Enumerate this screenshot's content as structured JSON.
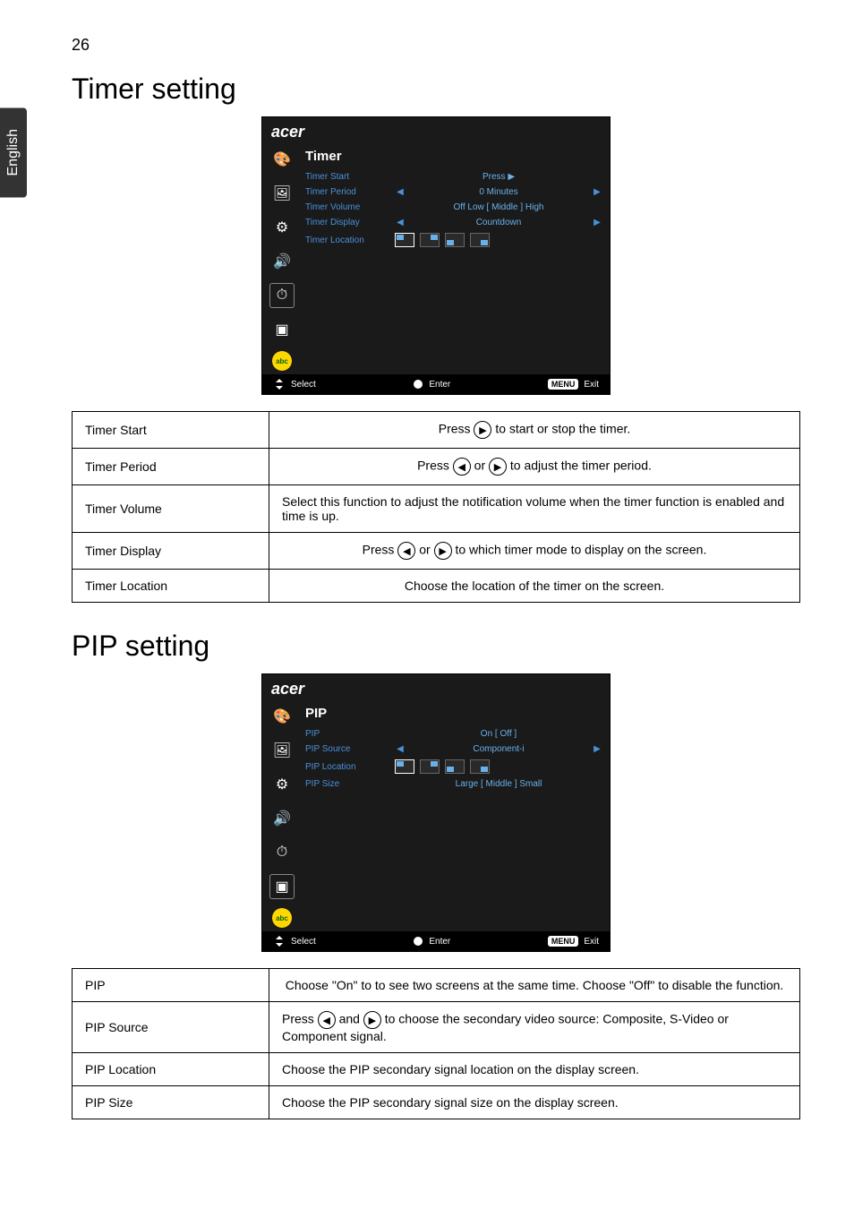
{
  "page_number": "26",
  "side_tab": "English",
  "section_timer": {
    "heading": "Timer setting",
    "osd": {
      "logo": "acer",
      "title": "Timer",
      "rows": [
        {
          "label": "Timer Start",
          "value": "Press  ▶"
        },
        {
          "label": "Timer Period",
          "value": "0  Minutes"
        },
        {
          "label": "Timer Volume",
          "value": "Off    Low    [ Middle ]    High"
        },
        {
          "label": "Timer Display",
          "value": "Countdown"
        },
        {
          "label": "Timer Location",
          "value": ""
        }
      ],
      "footer": {
        "select": "Select",
        "enter": "Enter",
        "exit_badge": "MENU",
        "exit": "Exit"
      }
    },
    "table": [
      {
        "name": "Timer Start",
        "desc_pre": "Press ",
        "icon": "▶",
        "desc_post": " to start or stop the timer."
      },
      {
        "name": "Timer Period",
        "desc_pre": "Press ",
        "icon": "◀",
        "desc_mid": " or ",
        "icon2": "▶",
        "desc_post": " to adjust the timer period."
      },
      {
        "name": "Timer Volume",
        "desc": "Select this function to adjust the notification volume when the timer function is enabled and time is up."
      },
      {
        "name": "Timer Display",
        "desc_pre": "Press ",
        "icon": "◀",
        "desc_mid": " or ",
        "icon2": "▶",
        "desc_post": " to which timer mode to display on the screen."
      },
      {
        "name": "Timer Location",
        "desc": "Choose the location of the timer on the screen."
      }
    ]
  },
  "section_pip": {
    "heading": "PIP setting",
    "osd": {
      "logo": "acer",
      "title": "PIP",
      "rows": [
        {
          "label": "PIP",
          "value": "On           [  Off  ]"
        },
        {
          "label": "PIP Source",
          "value": "Component-i"
        },
        {
          "label": "PIP Location",
          "value": ""
        },
        {
          "label": "PIP Size",
          "value": "Large    [ Middle ]    Small"
        }
      ],
      "footer": {
        "select": "Select",
        "enter": "Enter",
        "exit_badge": "MENU",
        "exit": "Exit"
      }
    },
    "table": [
      {
        "name": "PIP",
        "desc": "Choose \"On\" to to see two screens at the same time. Choose \"Off\" to disable the function."
      },
      {
        "name": "PIP Source",
        "desc_pre": "Press ",
        "icon": "◀",
        "desc_mid": " and ",
        "icon2": "▶",
        "desc_post": " to choose the secondary video source: Composite, S-Video or Component signal."
      },
      {
        "name": "PIP Location",
        "desc": "Choose the PIP secondary signal location on the display screen."
      },
      {
        "name": "PIP Size",
        "desc": "Choose the PIP secondary signal size on the display screen."
      }
    ]
  }
}
